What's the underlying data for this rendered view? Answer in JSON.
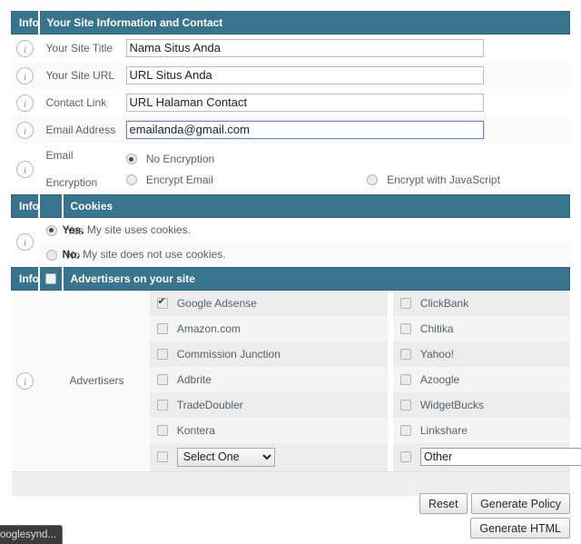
{
  "sections": {
    "site_info": {
      "info_col_header": "Info",
      "title": "Your Site Information and Contact",
      "fields": [
        {
          "label": "Your Site Title",
          "value": "Nama Situs Anda",
          "focused": false
        },
        {
          "label": "Your Site URL",
          "value": "URL Situs Anda",
          "focused": false
        },
        {
          "label": "Contact Link",
          "value": "URL Halaman Contact",
          "focused": false
        },
        {
          "label": "Email Address",
          "value": "emailanda@gmail.com",
          "focused": true
        }
      ],
      "encryption": {
        "label_line1": "Email",
        "label_line2": "Encryption",
        "options": [
          {
            "label": "No Encryption",
            "selected": true
          },
          {
            "label": "Encrypt Email",
            "selected": false
          },
          {
            "label": "Encrypt with JavaScript",
            "selected": false
          }
        ]
      }
    },
    "cookies": {
      "info_col_header": "Info",
      "title": "Cookies",
      "rows": [
        {
          "option": "Yes",
          "selected": true,
          "desc_strong": "Yes.",
          "desc_rest": " My site uses cookies."
        },
        {
          "option": "No",
          "selected": false,
          "desc_strong": "No.",
          "desc_rest": " My site does not use cookies."
        }
      ]
    },
    "advertisers": {
      "info_col_header": "Info",
      "title": "Advertisers on your site",
      "header_checkbox_checked": false,
      "row_label": "Advertisers",
      "left_column": [
        {
          "label": "Google Adsense",
          "checked": true
        },
        {
          "label": "Amazon.com",
          "checked": false
        },
        {
          "label": "Commission Junction",
          "checked": false
        },
        {
          "label": "Adbrite",
          "checked": false
        },
        {
          "label": "TradeDoubler",
          "checked": false
        },
        {
          "label": "Kontera",
          "checked": false
        }
      ],
      "right_column": [
        {
          "label": "ClickBank",
          "checked": false
        },
        {
          "label": "Chitika",
          "checked": false
        },
        {
          "label": "Yahoo!",
          "checked": false
        },
        {
          "label": "Azoogle",
          "checked": false
        },
        {
          "label": "WidgetBucks",
          "checked": false
        },
        {
          "label": "Linkshare",
          "checked": false
        }
      ],
      "last_row": {
        "select_checked": false,
        "select_value": "Select One",
        "select_options": [
          "Select One"
        ],
        "other_checked": false,
        "other_value": "Other"
      }
    }
  },
  "buttons": {
    "reset": "Reset",
    "generate_policy": "Generate Policy",
    "generate_html": "Generate HTML"
  },
  "statusbar": {
    "text": "ooglesynd..."
  },
  "colors": {
    "header_bar": "#39748f",
    "header_border": "#2f6580",
    "focus_border": "#6f7fcf",
    "row_alt": "#fafafa",
    "adv_cell": "#ececec",
    "adv_cell_alt": "#f4f4f4",
    "statusbar_bg": "#3b3b3b"
  }
}
